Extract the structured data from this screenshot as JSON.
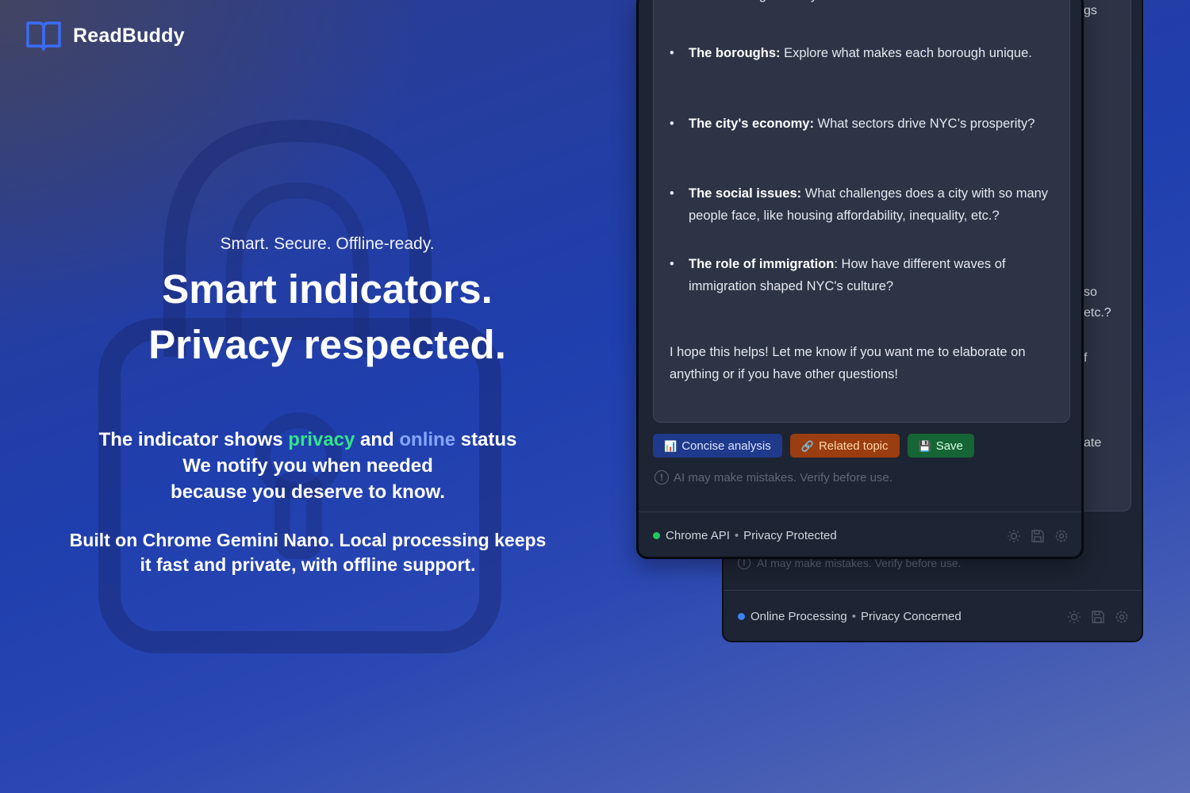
{
  "brand": {
    "name": "ReadBuddy",
    "accent": "#3b6cf6"
  },
  "hero": {
    "tagline": "Smart. Secure. Offline-ready.",
    "headline_line1": "Smart indicators.",
    "headline_line2": "Privacy respected."
  },
  "description": {
    "line1_pre": "The indicator shows ",
    "line1_privacy": "privacy",
    "line1_mid": " and ",
    "line1_online": "online",
    "line1_post": " status",
    "line2": "We notify you when needed",
    "line3": "because you deserve to know.",
    "privacy_color": "#34e38c",
    "online_color": "#86a6ff"
  },
  "built": {
    "line1": "Built on Chrome Gemini Nano. Local processing keeps",
    "line2": "it fast and private, with offline support."
  },
  "front_panel": {
    "intro": "settlement to a global city?",
    "bullets": [
      {
        "bold": "The boroughs:",
        "text": " Explore what makes each borough unique."
      },
      {
        "bold": "The city's economy:",
        "text": " What sectors drive NYC’s prosperity?"
      },
      {
        "bold": "The social issues:",
        "text": " What challenges does a city with so many people face, like housing affordability, inequality, etc.?"
      },
      {
        "bold": "The role of immigration",
        "text": ": How have different waves of immigration shaped NYC's culture?"
      }
    ],
    "closing": "I hope this helps! Let me know if you want me to elaborate on anything or if you have other questions!",
    "actions": {
      "concise": {
        "icon": "📊",
        "label": "Concise analysis"
      },
      "related": {
        "icon": "🔗",
        "label": "Related topic"
      },
      "save": {
        "icon": "💾",
        "label": "Save"
      }
    },
    "warning": "AI may make mistakes. Verify before use.",
    "warning_icon": "!",
    "status": {
      "source": "Chrome API",
      "privacy": "Privacy Protected",
      "dot_color": "#22c55e"
    }
  },
  "back_panel": {
    "fragments": [
      "gs",
      "so",
      "etc.?",
      "f",
      "ate"
    ],
    "warning": "AI may make mistakes. Verify before use.",
    "status": {
      "source": "Online Processing",
      "privacy": "Privacy Concerned",
      "dot_color": "#3b82f6"
    }
  },
  "footer_icons": [
    "sun-icon",
    "save-icon",
    "gear-icon"
  ]
}
